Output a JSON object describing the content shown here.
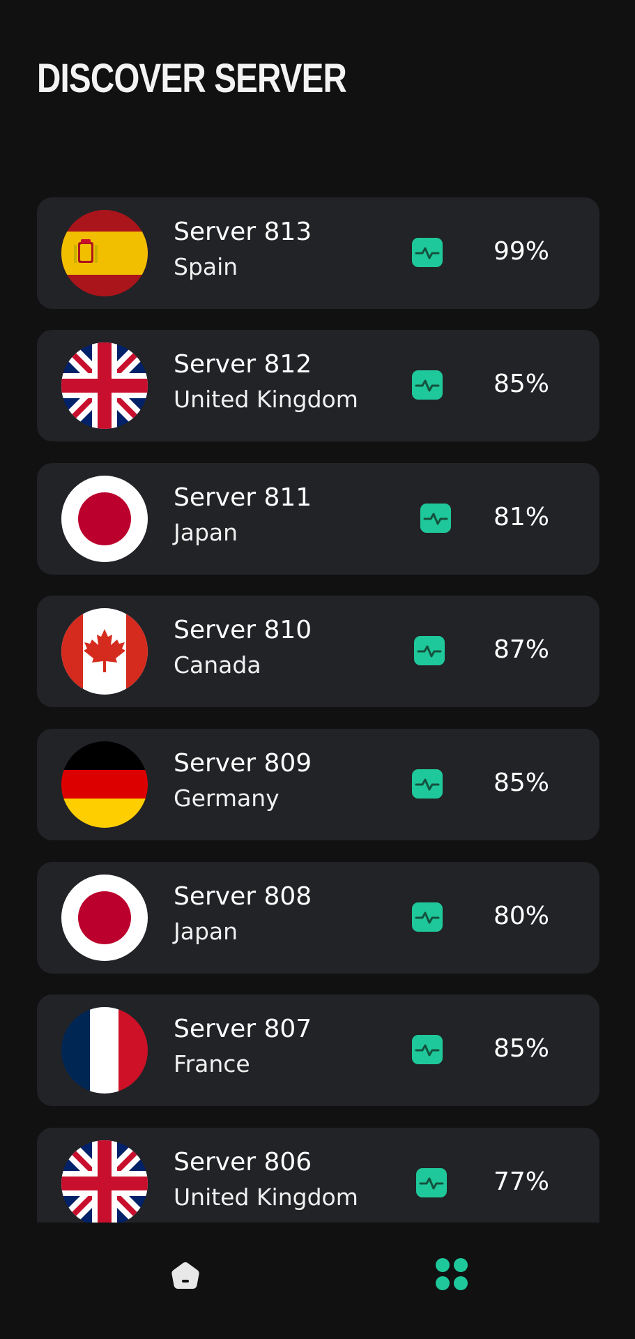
{
  "header": {
    "title": "DISCOVER SERVER"
  },
  "colors": {
    "background": "#111112",
    "card": "#222327",
    "accent": "#1fc89a"
  },
  "servers": [
    {
      "name": "Server 813",
      "country": "Spain",
      "load": "99%",
      "flag": "spain-flag-icon"
    },
    {
      "name": "Server 812",
      "country": "United Kingdom",
      "load": "85%",
      "flag": "uk-flag-icon"
    },
    {
      "name": "Server 811",
      "country": "Japan",
      "load": "81%",
      "flag": "japan-flag-icon"
    },
    {
      "name": "Server 810",
      "country": "Canada",
      "load": "87%",
      "flag": "canada-flag-icon"
    },
    {
      "name": "Server 809",
      "country": "Germany",
      "load": "85%",
      "flag": "germany-flag-icon"
    },
    {
      "name": "Server 808",
      "country": "Japan",
      "load": "80%",
      "flag": "japan-flag-icon"
    },
    {
      "name": "Server 807",
      "country": "France",
      "load": "85%",
      "flag": "france-flag-icon"
    },
    {
      "name": "Server 806",
      "country": "United Kingdom",
      "load": "77%",
      "flag": "uk-flag-icon"
    }
  ],
  "nav": {
    "items": [
      {
        "icon": "home-icon"
      },
      {
        "icon": "apps-grid-icon"
      }
    ]
  }
}
